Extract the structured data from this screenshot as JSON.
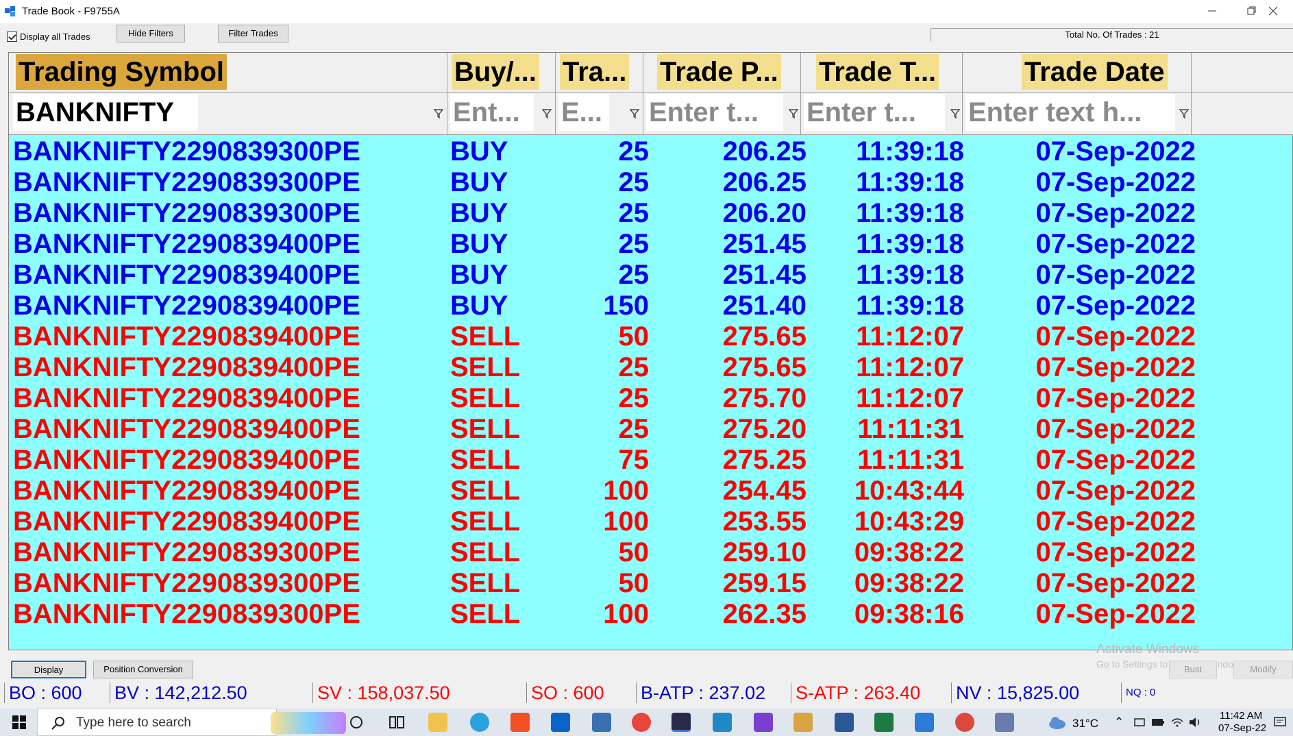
{
  "window": {
    "title": "Trade Book - F9755A"
  },
  "toolbar": {
    "display_all_label": "Display all Trades",
    "hide_filters": "Hide Filters",
    "filter_trades": "Filter Trades",
    "total_trades": "Total No. Of Trades : 21"
  },
  "columns": [
    {
      "header": "Trading Symbol",
      "filter_value": "BANKNIFTY",
      "filter_placeholder": ""
    },
    {
      "header": "Buy/...",
      "filter_value": "",
      "filter_placeholder": "Ent..."
    },
    {
      "header": "Tra...",
      "filter_value": "",
      "filter_placeholder": "E..."
    },
    {
      "header": "Trade P...",
      "filter_value": "",
      "filter_placeholder": "Enter t..."
    },
    {
      "header": "Trade T...",
      "filter_value": "",
      "filter_placeholder": "Enter t..."
    },
    {
      "header": "Trade Date",
      "filter_value": "",
      "filter_placeholder": "Enter text h..."
    }
  ],
  "rows": [
    {
      "symbol": "BANKNIFTY2290839300PE",
      "side": "BUY",
      "qty": "25",
      "price": "206.25",
      "time": "11:39:18",
      "date": "07-Sep-2022"
    },
    {
      "symbol": "BANKNIFTY2290839300PE",
      "side": "BUY",
      "qty": "25",
      "price": "206.25",
      "time": "11:39:18",
      "date": "07-Sep-2022"
    },
    {
      "symbol": "BANKNIFTY2290839300PE",
      "side": "BUY",
      "qty": "25",
      "price": "206.20",
      "time": "11:39:18",
      "date": "07-Sep-2022"
    },
    {
      "symbol": "BANKNIFTY2290839400PE",
      "side": "BUY",
      "qty": "25",
      "price": "251.45",
      "time": "11:39:18",
      "date": "07-Sep-2022"
    },
    {
      "symbol": "BANKNIFTY2290839400PE",
      "side": "BUY",
      "qty": "25",
      "price": "251.45",
      "time": "11:39:18",
      "date": "07-Sep-2022"
    },
    {
      "symbol": "BANKNIFTY2290839400PE",
      "side": "BUY",
      "qty": "150",
      "price": "251.40",
      "time": "11:39:18",
      "date": "07-Sep-2022"
    },
    {
      "symbol": "BANKNIFTY2290839400PE",
      "side": "SELL",
      "qty": "50",
      "price": "275.65",
      "time": "11:12:07",
      "date": "07-Sep-2022"
    },
    {
      "symbol": "BANKNIFTY2290839400PE",
      "side": "SELL",
      "qty": "25",
      "price": "275.65",
      "time": "11:12:07",
      "date": "07-Sep-2022"
    },
    {
      "symbol": "BANKNIFTY2290839400PE",
      "side": "SELL",
      "qty": "25",
      "price": "275.70",
      "time": "11:12:07",
      "date": "07-Sep-2022"
    },
    {
      "symbol": "BANKNIFTY2290839400PE",
      "side": "SELL",
      "qty": "25",
      "price": "275.20",
      "time": "11:11:31",
      "date": "07-Sep-2022"
    },
    {
      "symbol": "BANKNIFTY2290839400PE",
      "side": "SELL",
      "qty": "75",
      "price": "275.25",
      "time": "11:11:31",
      "date": "07-Sep-2022"
    },
    {
      "symbol": "BANKNIFTY2290839400PE",
      "side": "SELL",
      "qty": "100",
      "price": "254.45",
      "time": "10:43:44",
      "date": "07-Sep-2022"
    },
    {
      "symbol": "BANKNIFTY2290839400PE",
      "side": "SELL",
      "qty": "100",
      "price": "253.55",
      "time": "10:43:29",
      "date": "07-Sep-2022"
    },
    {
      "symbol": "BANKNIFTY2290839300PE",
      "side": "SELL",
      "qty": "50",
      "price": "259.10",
      "time": "09:38:22",
      "date": "07-Sep-2022"
    },
    {
      "symbol": "BANKNIFTY2290839300PE",
      "side": "SELL",
      "qty": "50",
      "price": "259.15",
      "time": "09:38:22",
      "date": "07-Sep-2022"
    },
    {
      "symbol": "BANKNIFTY2290839300PE",
      "side": "SELL",
      "qty": "100",
      "price": "262.35",
      "time": "09:38:16",
      "date": "07-Sep-2022"
    }
  ],
  "watermark": {
    "line1": "Activate Windows",
    "line2": "Go to Settings to activate Windows."
  },
  "bottom_buttons": {
    "display": "Display",
    "position_conversion": "Position Conversion",
    "bust": "Bust",
    "modify": "Modify"
  },
  "status": {
    "bo": "BO : 600",
    "bv": "BV : 142,212.50",
    "sv": "SV : 158,037.50",
    "so": "SO : 600",
    "batp": "B-ATP : 237.02",
    "satp": "S-ATP : 263.40",
    "nv": "NV : 15,825.00",
    "nq": "NQ : 0"
  },
  "taskbar": {
    "search_placeholder": "Type here to search",
    "weather": "31°C",
    "time": "11:42 AM",
    "date": "07-Sep-22"
  },
  "colors": {
    "grid_bg": "#8effff",
    "header_bg": "#e8c86a",
    "buy": "#0000ee",
    "sell": "#ff0000"
  }
}
